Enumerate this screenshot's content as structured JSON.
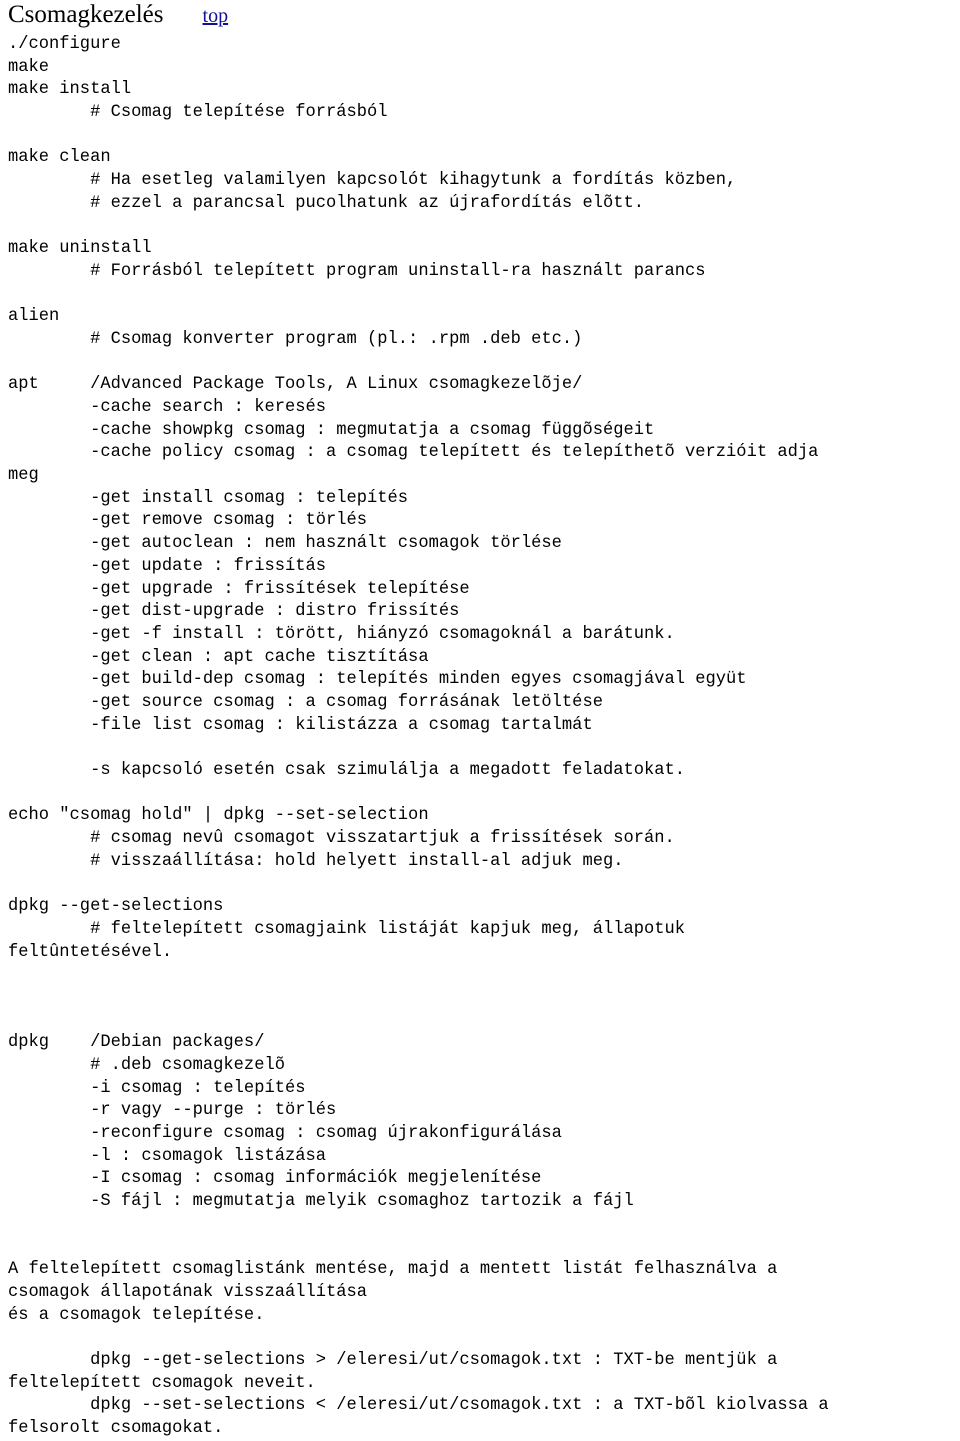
{
  "header": {
    "title": "Csomagkezelés",
    "top_link": "top",
    "link_color": "#101099"
  },
  "document": {
    "language": "hu",
    "body_lines": [
      "./configure",
      "make",
      "make install",
      "        # Csomag telepítése forrásból",
      "",
      "make clean",
      "        # Ha esetleg valamilyen kapcsolót kihagytunk a fordítás közben,",
      "        # ezzel a parancsal pucolhatunk az újrafordítás elõtt.",
      "",
      "make uninstall",
      "        # Forrásból telepített program uninstall-ra használt parancs",
      "",
      "alien",
      "        # Csomag konverter program (pl.: .rpm .deb etc.)",
      "",
      "apt     /Advanced Package Tools, A Linux csomagkezelõje/",
      "        -cache search : keresés",
      "        -cache showpkg csomag : megmutatja a csomag függõségeit",
      "        -cache policy csomag : a csomag telepített és telepíthetõ verzióit adja",
      "meg",
      "        -get install csomag : telepítés",
      "        -get remove csomag : törlés",
      "        -get autoclean : nem használt csomagok törlése",
      "        -get update : frissítás",
      "        -get upgrade : frissítések telepítése",
      "        -get dist-upgrade : distro frissítés",
      "        -get -f install : törött, hiányzó csomagoknál a barátunk.",
      "        -get clean : apt cache tisztítása",
      "        -get build-dep csomag : telepítés minden egyes csomagjával együt",
      "        -get source csomag : a csomag forrásának letöltése",
      "        -file list csomag : kilistázza a csomag tartalmát",
      "",
      "        -s kapcsoló esetén csak szimulálja a megadott feladatokat.",
      "",
      "echo \"csomag hold\" | dpkg --set-selection",
      "        # csomag nevû csomagot visszatartjuk a frissítések során.",
      "        # visszaállítása: hold helyett install-al adjuk meg.",
      "",
      "dpkg --get-selections",
      "        # feltelepített csomagjaink listáját kapjuk meg, állapotuk",
      "feltûntetésével.",
      "",
      "",
      "",
      "dpkg    /Debian packages/",
      "        # .deb csomagkezelõ",
      "        -i csomag : telepítés",
      "        -r vagy --purge : törlés",
      "        -reconfigure csomag : csomag újrakonfigurálása",
      "        -l : csomagok listázása",
      "        -I csomag : csomag információk megjelenítése",
      "        -S fájl : megmutatja melyik csomaghoz tartozik a fájl",
      "",
      "",
      "A feltelepített csomaglistánk mentése, majd a mentett listát felhasználva a",
      "csomagok állapotának visszaállítása",
      "és a csomagok telepítése.",
      "",
      "        dpkg --get-selections > /eleresi/ut/csomagok.txt : TXT-be mentjük a",
      "feltelepített csomagok neveit.",
      "        dpkg --set-selections < /eleresi/ut/csomagok.txt : a TXT-bõl kiolvassa a",
      "felsorolt csomagokat."
    ]
  }
}
